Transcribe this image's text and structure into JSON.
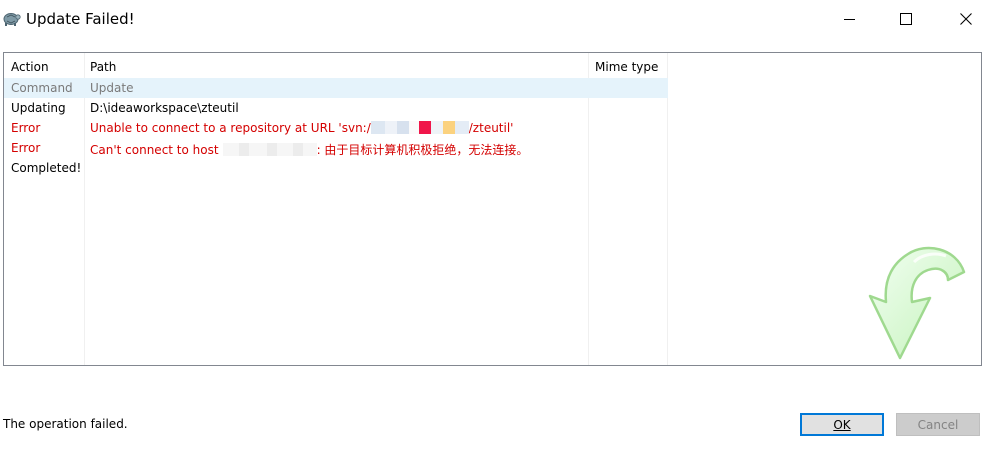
{
  "window": {
    "title": "Update Failed!"
  },
  "list": {
    "columns": [
      "Action",
      "Path",
      "Mime type"
    ],
    "rows": [
      {
        "action": "Command",
        "path": "Update",
        "style": "gray"
      },
      {
        "action": "Updating",
        "path": "D:\\ideaworkspace\\zteutil",
        "style": "black"
      },
      {
        "action": "Error",
        "path_prefix": "Unable to connect to a repository at URL 'svn:/",
        "path_suffix": "/zteutil'",
        "style": "red"
      },
      {
        "action": "Error",
        "path_prefix": "Can't connect to host",
        "path_suffix": ": 由于目标计算机积极拒绝，无法连接。",
        "style": "red"
      },
      {
        "action": "Completed!",
        "path": "",
        "style": "black"
      }
    ]
  },
  "footer": {
    "status": "The operation failed.",
    "ok_label": "OK",
    "cancel_label": "Cancel"
  },
  "colors": {
    "error": "#d40000",
    "muted": "#7a7a7a",
    "selection": "#e5f3fb",
    "accent": "#0078d7"
  },
  "icons": {
    "app": "tortoise-icon",
    "big": "update-arrow-icon"
  }
}
